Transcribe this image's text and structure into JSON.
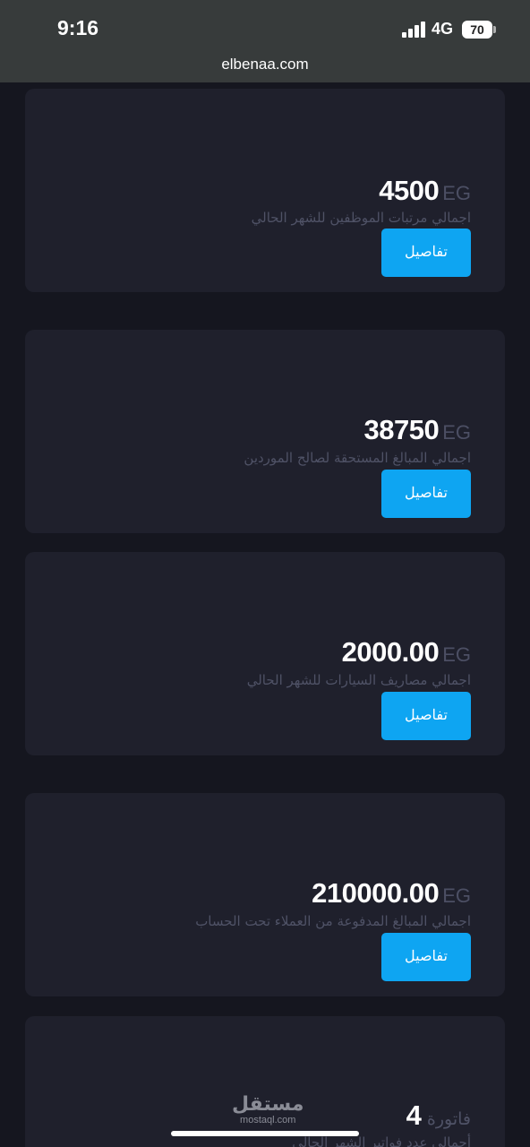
{
  "status_bar": {
    "time": "9:16",
    "network": "4G",
    "battery": "70"
  },
  "browser": {
    "url": "elbenaa.com"
  },
  "cards": [
    {
      "currency": "EG",
      "amount": "4500",
      "label": "اجمالي مرتبات الموظفين للشهر الحالي",
      "button": "تفاصيل"
    },
    {
      "currency": "EG",
      "amount": "38750",
      "label": "اجمالي المبالغ المستحقة لصالح الموردين",
      "button": "تفاصيل"
    },
    {
      "currency": "EG",
      "amount": "2000.00",
      "label": "اجمالي مصاريف السيارات للشهر الحالي",
      "button": "تفاصيل"
    },
    {
      "currency": "EG",
      "amount": "210000.00",
      "label": "اجمالي المبالغ المدفوعة من العملاء تحت الحساب",
      "button": "تفاصيل"
    },
    {
      "unit": "فاتورة",
      "amount": "4",
      "label": "أجمالي عدد فواتير الشهر الحالي"
    }
  ],
  "watermark": {
    "arabic": "مستقل",
    "latin": "mostaql.com"
  },
  "colors": {
    "accent": "#0ea5f2",
    "card": "#1f202c",
    "background": "#15161f"
  }
}
